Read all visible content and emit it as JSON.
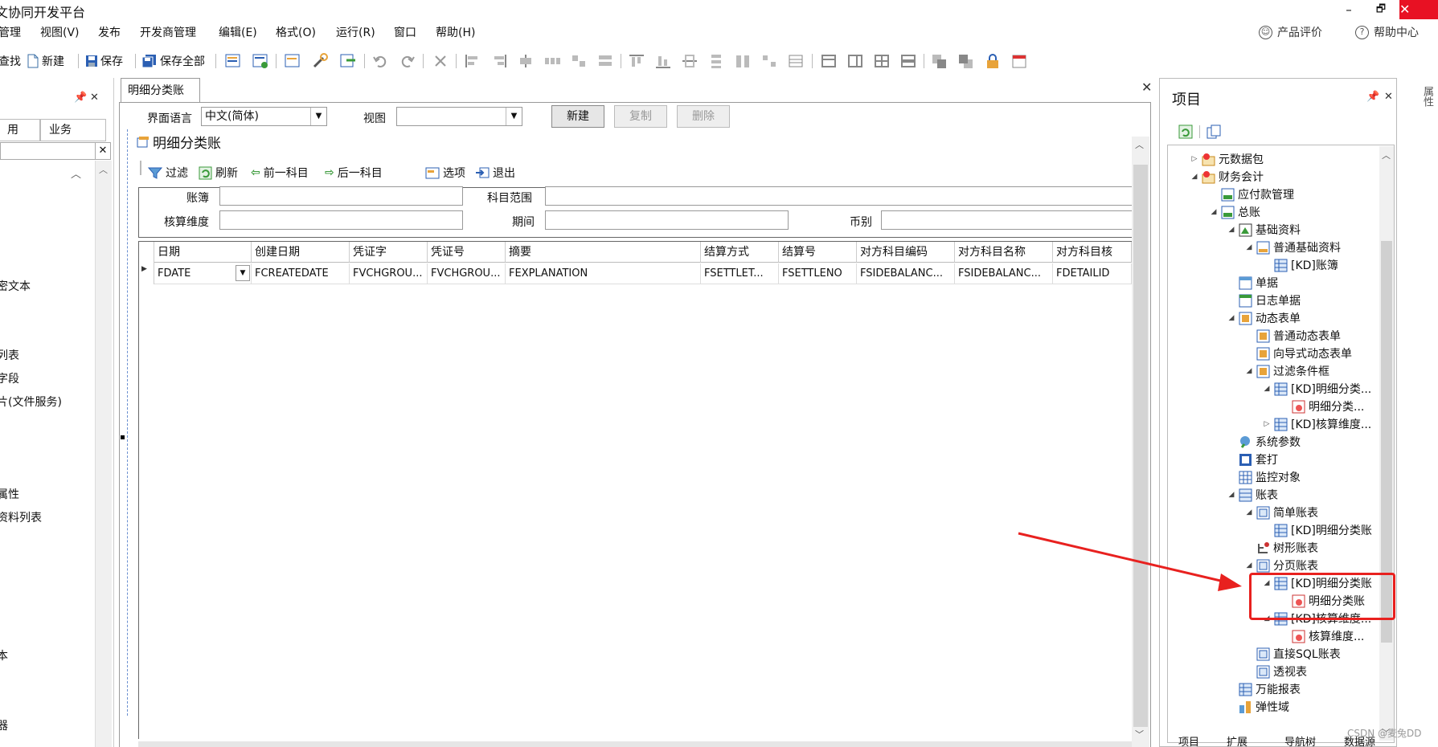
{
  "window": {
    "title": "文协同开发平台",
    "minimize": "–",
    "restore": "🗗",
    "close": "✕"
  },
  "menu": {
    "items": [
      "管理",
      "视图(V)",
      "发布",
      "开发商管理",
      "编辑(E)",
      "格式(O)",
      "运行(R)",
      "窗口",
      "帮助(H)"
    ],
    "product_review": "产品评价",
    "help_center": "帮助中心"
  },
  "toolbar": {
    "find": "查找",
    "new": "新建",
    "save": "保存",
    "save_all": "保存全部"
  },
  "left_panel": {
    "pin": "📌",
    "close": "✕",
    "tab_common": "用",
    "tab_business": "业务",
    "items": [
      "密文本",
      "列表",
      "字段",
      "片(文件服务)",
      "属性",
      "资料列表",
      "本",
      "器"
    ]
  },
  "document": {
    "tab_label": "明细分类账",
    "close": "✕",
    "ui_language_label": "界面语言",
    "ui_language_value": "中文(简体)",
    "view_label": "视图",
    "view_value": "",
    "new_button": "新建",
    "copy_button": "复制",
    "delete_button": "删除",
    "form_title": "明细分类账",
    "inner_toolbar": {
      "filter": "过滤",
      "refresh": "刷新",
      "prev": "前一科目",
      "next": "后一科目",
      "options": "选项",
      "exit": "退出"
    },
    "filter": {
      "book_label": "账簿",
      "subject_range_label": "科目范围",
      "dimension_label": "核算维度",
      "period_label": "期间",
      "currency_label": "币别"
    },
    "grid": {
      "headers": [
        "日期",
        "创建日期",
        "凭证字",
        "凭证号",
        "摘要",
        "结算方式",
        "结算号",
        "对方科目编码",
        "对方科目名称",
        "对方科目核"
      ],
      "row": [
        "FDATE",
        "FCREATEDATE",
        "FVCHGROU...",
        "FVCHGROU...",
        "FEXPLANATION",
        "FSETTLET...",
        "FSETTLENO",
        "FSIDEBALANC...",
        "FSIDEBALANC...",
        "FDETAILID"
      ]
    }
  },
  "project_panel": {
    "title": "项目",
    "pin": "📌",
    "close": "✕",
    "tree": [
      "元数据包",
      "财务会计",
      "应付款管理",
      "总账",
      "基础资料",
      "普通基础资料",
      "[KD]账簿",
      "单据",
      "日志单据",
      "动态表单",
      "普通动态表单",
      "向导式动态表单",
      "过滤条件框",
      "[KD]明细分类...",
      "明细分类...",
      "[KD]核算维度...",
      "系统参数",
      "套打",
      "监控对象",
      "账表",
      "简单账表",
      "[KD]明细分类账",
      "树形账表",
      "分页账表",
      "[KD]明细分类账",
      "明细分类账",
      "[KD]核算维度...",
      "核算维度...",
      "直接SQL账表",
      "透视表",
      "万能报表",
      "弹性域"
    ],
    "bottom_tabs": [
      "项目",
      "扩展",
      "导航树",
      "数据源"
    ]
  },
  "side_strip_label": "属性",
  "watermark": "CSDN @麦兔DD",
  "colors": {
    "highlight": "#e8211f",
    "close_red": "#e81123"
  }
}
